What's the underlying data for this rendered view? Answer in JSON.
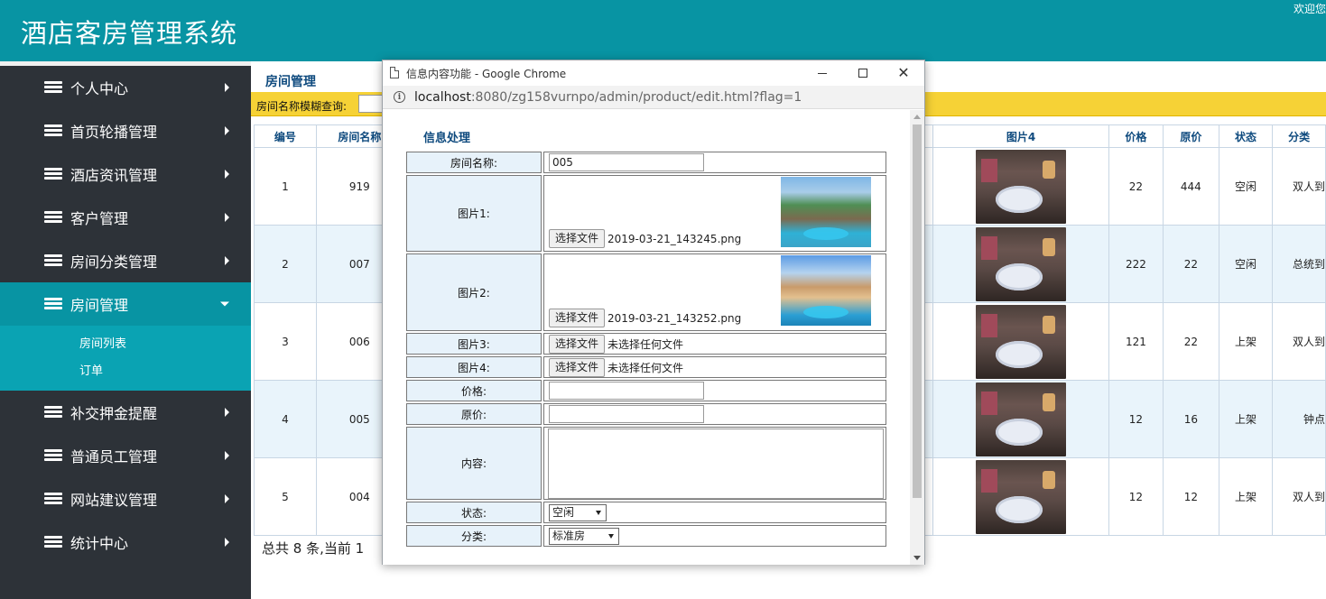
{
  "header": {
    "title": "酒店客房管理系统",
    "welcome": "欢迎您"
  },
  "sidebar": {
    "items": [
      {
        "label": "个人中心",
        "icon": "layers-icon"
      },
      {
        "label": "首页轮播管理",
        "icon": "layers-icon"
      },
      {
        "label": "酒店资讯管理",
        "icon": "layers-icon"
      },
      {
        "label": "客户管理",
        "icon": "layers-icon"
      },
      {
        "label": "房间分类管理",
        "icon": "layers-icon"
      },
      {
        "label": "房间管理",
        "icon": "layers-icon",
        "active": true
      },
      {
        "label": "补交押金提醒",
        "icon": "layers-icon"
      },
      {
        "label": "普通员工管理",
        "icon": "layers-icon"
      },
      {
        "label": "网站建议管理",
        "icon": "layers-icon"
      },
      {
        "label": "统计中心",
        "icon": "layers-icon"
      }
    ],
    "submenu": [
      "房间列表",
      "订单"
    ]
  },
  "main": {
    "title": "房间管理",
    "search_label": "房间名称模糊查询:",
    "columns": [
      "编号",
      "房间名称",
      "图片4",
      "价格",
      "原价",
      "状态",
      "分类"
    ],
    "rows": [
      {
        "id": "1",
        "name": "919",
        "price": "22",
        "orig": "444",
        "status": "空闲",
        "category": "双人到"
      },
      {
        "id": "2",
        "name": "007",
        "price": "222",
        "orig": "22",
        "status": "空闲",
        "category": "总统到"
      },
      {
        "id": "3",
        "name": "006",
        "price": "121",
        "orig": "22",
        "status": "上架",
        "category": "双人到"
      },
      {
        "id": "4",
        "name": "005",
        "price": "12",
        "orig": "16",
        "status": "上架",
        "category": "钟点"
      },
      {
        "id": "5",
        "name": "004",
        "price": "12",
        "orig": "12",
        "status": "上架",
        "category": "双人到"
      }
    ],
    "footer": "总共 8 条,当前 1"
  },
  "popup": {
    "window_title": "信息内容功能 - Google Chrome",
    "url_host": "localhost",
    "url_rest": ":8080/zg158vurnpo/admin/product/edit.html?flag=1",
    "form_title": "信息处理",
    "fields": {
      "name_label": "房间名称:",
      "name_value": "005",
      "img1_label": "图片1:",
      "img1_file": "2019-03-21_143245.png",
      "img2_label": "图片2:",
      "img2_file": "2019-03-21_143252.png",
      "img3_label": "图片3:",
      "img3_file": "未选择任何文件",
      "img4_label": "图片4:",
      "img4_file": "未选择任何文件",
      "choose_file": "选择文件",
      "price_label": "价格:",
      "price_value": "",
      "orig_label": "原价:",
      "orig_value": "",
      "content_label": "内容:",
      "status_label": "状态:",
      "status_value": "空闲",
      "category_label": "分类:",
      "category_value": "标准房"
    }
  }
}
